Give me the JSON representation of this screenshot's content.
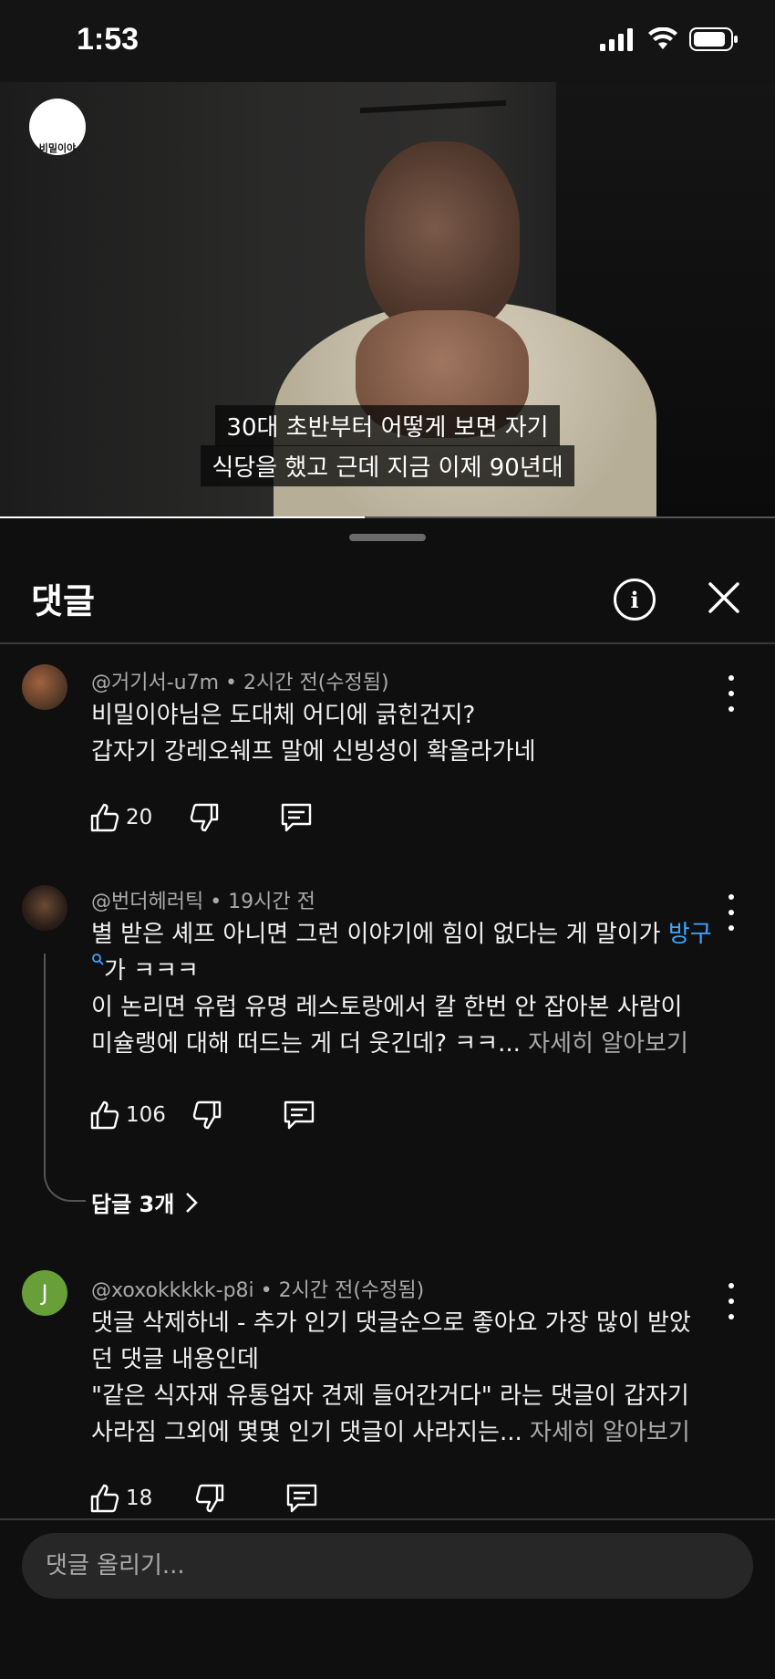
{
  "status_bar": {
    "time": "1:53"
  },
  "video": {
    "channel_logo_text": "비밀이야",
    "caption_line1": "30대 초반부터 어떻게 보면 자기",
    "caption_line2": "식당을 했고 근데 지금 이제 90년대",
    "progress": 0.47
  },
  "sheet": {
    "title": "댓글"
  },
  "comments": [
    {
      "handle": "@거기서-u7m",
      "time": "• 2시간 전(수정됨)",
      "line1": "비밀이야님은 도대체 어디에 긁힌건지?",
      "line2": "갑자기 강레오쉐프 말에 신빙성이 확올라가네",
      "likes": "20"
    },
    {
      "handle": "@번더헤러틱",
      "time": "• 19시간 전",
      "line1_prefix": "별 받은 셰프 아니면 그런 이야기에 힘이 없다는 게 말이가 ",
      "link": "방구",
      "line2_suffix": "가 ㅋㅋㅋ",
      "line3": "이 논리면 유럽 유명 레스토랑에서 칼 한번 안 잡아본 사람이",
      "line4": "미슐랭에 대해 떠드는 게 더 웃긴데? ㅋㅋ...",
      "read_more": "자세히 알아보기",
      "likes": "106",
      "replies": "답글 3개"
    },
    {
      "avatar_letter": "J",
      "handle": "@xoxokkkkk-p8i",
      "time": "• 2시간 전(수정됨)",
      "line1": "댓글 삭제하네 - 추가 인기 댓글순으로 좋아요 가장 많이 받았",
      "line2": "던 댓글 내용인데",
      "line3": "\"같은 식자재 유통업자 견제 들어간거다\" 라는 댓글이 갑자기",
      "line4": "사라짐 그외에 몇몇 인기 댓글이 사라지는...",
      "read_more": "자세히 알아보기",
      "likes": "18"
    }
  ],
  "composer": {
    "placeholder": "댓글 올리기..."
  },
  "colors": {
    "background": "#0f0f0f",
    "link": "#3ea6ff",
    "avatar_j": "#689f38"
  }
}
